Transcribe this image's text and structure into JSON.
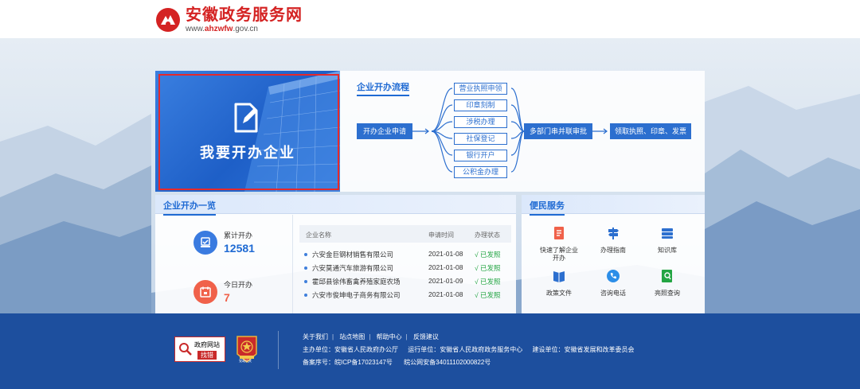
{
  "header": {
    "site_name": "安徽政务服务网",
    "url_prefix": "www.",
    "url_domain": "ahzwfw",
    "url_suffix": ".gov.cn"
  },
  "hero": {
    "label": "我要开办企业",
    "icon": "edit-document-icon"
  },
  "flow": {
    "title": "企业开办流程",
    "start": "开办企业申请",
    "steps": [
      "营业执照申领",
      "印章刻制",
      "涉税办理",
      "社保登记",
      "银行开户",
      "公积金办理"
    ],
    "approval": "多部门串并联审批",
    "finish": "领取执照、印章、发票"
  },
  "overview": {
    "title": "企业开办一览",
    "total_label": "累计开办",
    "total_value": "12581",
    "today_label": "今日开办",
    "today_value": "7",
    "table": {
      "columns": [
        "企业名称",
        "申请时间",
        "办理状态"
      ],
      "rows": [
        {
          "name": "六安金巨钢材销售有限公司",
          "date": "2021-01-08",
          "status": "√ 已发照"
        },
        {
          "name": "六安莫通汽车旅游有限公司",
          "date": "2021-01-08",
          "status": "√ 已发照"
        },
        {
          "name": "霍邱县徐伟畜禽养殖家庭农场",
          "date": "2021-01-09",
          "status": "√ 已发照"
        },
        {
          "name": "六安市俊坤电子商务有限公司",
          "date": "2021-01-08",
          "status": "√ 已发照"
        }
      ]
    }
  },
  "services": {
    "title": "便民服务",
    "items": [
      {
        "label": "快速了解企业",
        "label2": "开办",
        "icon": "document-icon"
      },
      {
        "label": "办理指南",
        "label2": "",
        "icon": "signpost-icon"
      },
      {
        "label": "知识库",
        "label2": "",
        "icon": "database-icon"
      },
      {
        "label": "政策文件",
        "label2": "",
        "icon": "book-icon"
      },
      {
        "label": "咨询电话",
        "label2": "",
        "icon": "phone-icon"
      },
      {
        "label": "亮照查询",
        "label2": "",
        "icon": "search-license-icon"
      }
    ]
  },
  "footer": {
    "links": [
      "关于我们",
      "站点地图",
      "帮助中心",
      "反馈建议"
    ],
    "sponsor": "主办单位：安徽省人民政府办公厅",
    "operator": "运行单位：安徽省人民政府政务服务中心",
    "builder": "建设单位：安徽省发展和改革委员会",
    "icp": "备案序号：皖ICP备17023147号",
    "police": "皖公网安备34011102000822号",
    "badge_title": "政府网站",
    "badge_action": "找错",
    "emblem_text": "党政机关"
  },
  "colors": {
    "brand_red": "#d42222",
    "primary_blue": "#1f6ad3",
    "footer_blue": "#1d4f9e",
    "success_green": "#23a543",
    "stat_orange": "#f0614a"
  }
}
